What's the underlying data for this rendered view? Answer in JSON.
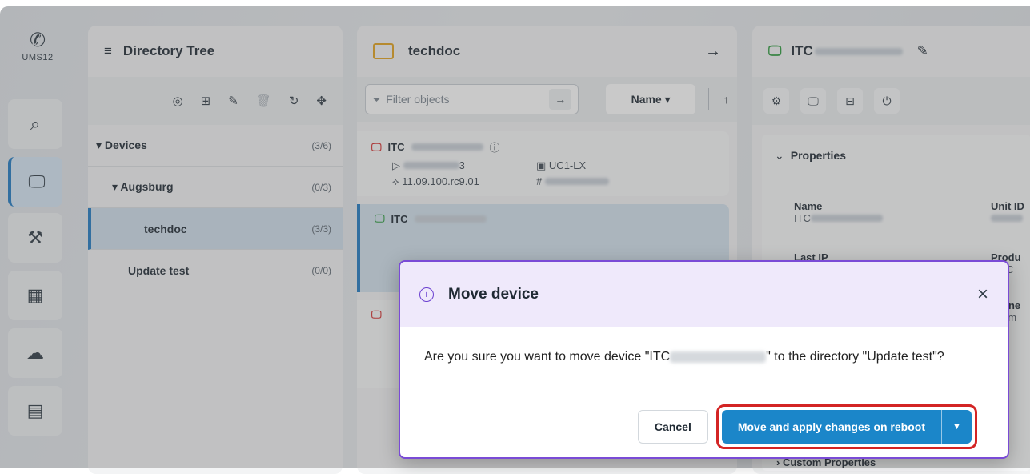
{
  "rail": {
    "logo_text": "UMS12",
    "items": [
      {
        "icon": "search-icon",
        "glyph": "⌕"
      },
      {
        "icon": "devices-icon",
        "glyph": "🖵"
      },
      {
        "icon": "configuration-icon",
        "glyph": "⚒"
      },
      {
        "icon": "apps-icon",
        "glyph": "▦"
      },
      {
        "icon": "cloud-icon",
        "glyph": "☁"
      },
      {
        "icon": "logs-icon",
        "glyph": "▤"
      }
    ]
  },
  "tree": {
    "title": "Directory Tree",
    "rows": [
      {
        "label": "Devices",
        "count": "(3/6)"
      },
      {
        "label": "Augsburg",
        "count": "(0/3)"
      },
      {
        "label": "techdoc",
        "count": "(3/3)"
      },
      {
        "label": "Update test",
        "count": "(0/0)"
      }
    ]
  },
  "list": {
    "title": "techdoc",
    "filter_placeholder": "Filter objects",
    "sort_label": "Name",
    "cards": [
      {
        "name_prefix": "ITC",
        "line1_left": "3",
        "line1_right": "UC1-LX",
        "line2_left": "11.09.100.rc9.01",
        "line2_right": "#"
      },
      {
        "name_prefix": "ITC"
      }
    ]
  },
  "props": {
    "title_prefix": "ITC",
    "section_title": "Properties",
    "fields": [
      {
        "key": "Name",
        "value": "ITC"
      },
      {
        "key": "Unit ID",
        "value": ""
      },
      {
        "key": "Last IP",
        "value": ""
      },
      {
        "key": "Produ",
        "value": "EL C"
      },
      {
        "key": "nne",
        "value": "um"
      }
    ],
    "custom_properties": "Custom Properties"
  },
  "modal": {
    "title": "Move device",
    "message_part1": "Are you sure you want to move device \"ITC",
    "message_part2": "\" to the directory \"Update test\"?",
    "cancel_label": "Cancel",
    "primary_label": "Move and apply changes on reboot"
  },
  "colors": {
    "accent": "#1b86c9",
    "modal_border": "#7a4bd6",
    "highlight_border": "#d32424"
  }
}
